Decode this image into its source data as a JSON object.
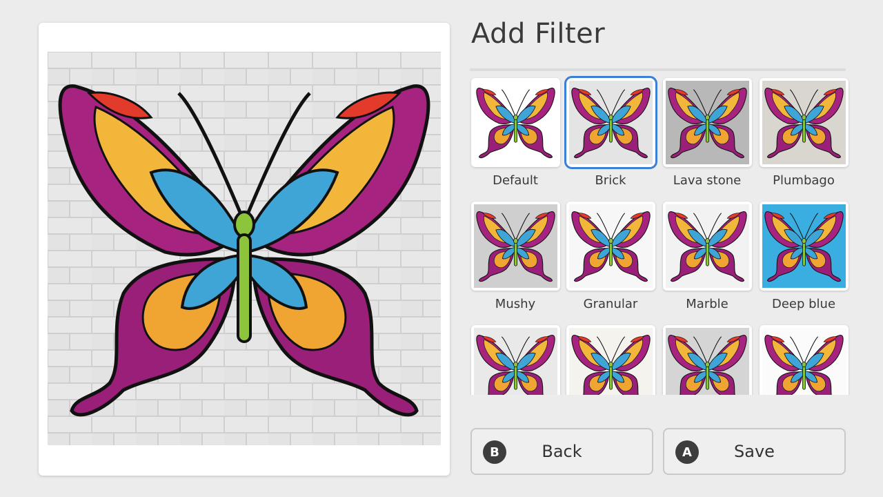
{
  "header": {
    "title": "Add Filter"
  },
  "preview": {
    "image": "butterfly-on-brick",
    "filter": "Brick"
  },
  "filters": [
    {
      "label": "Default",
      "bg": "#ffffff",
      "selected": false
    },
    {
      "label": "Brick",
      "bg": "#e4e4e4",
      "selected": true
    },
    {
      "label": "Lava stone",
      "bg": "#b8b8b8",
      "selected": false
    },
    {
      "label": "Plumbago",
      "bg": "#d9d6d0",
      "selected": false
    },
    {
      "label": "Mushy",
      "bg": "#cfcfcf",
      "selected": false
    },
    {
      "label": "Granular",
      "bg": "#f7f7f7",
      "selected": false
    },
    {
      "label": "Marble",
      "bg": "#f2f2f2",
      "selected": false
    },
    {
      "label": "Deep blue",
      "bg": "#3aaee0",
      "selected": false
    },
    {
      "label": "",
      "bg": "#e9e9e9",
      "selected": false
    },
    {
      "label": "",
      "bg": "#f5f3ee",
      "selected": false
    },
    {
      "label": "",
      "bg": "#d5d5d5",
      "selected": false
    },
    {
      "label": "",
      "bg": "#fbfbfb",
      "selected": false
    }
  ],
  "buttons": {
    "back": {
      "glyph": "B",
      "label": "Back"
    },
    "save": {
      "glyph": "A",
      "label": "Save"
    }
  },
  "colors": {
    "selection": "#3b7fd6",
    "brick": "#e6e6e6",
    "mortar": "#cfcfcf"
  }
}
